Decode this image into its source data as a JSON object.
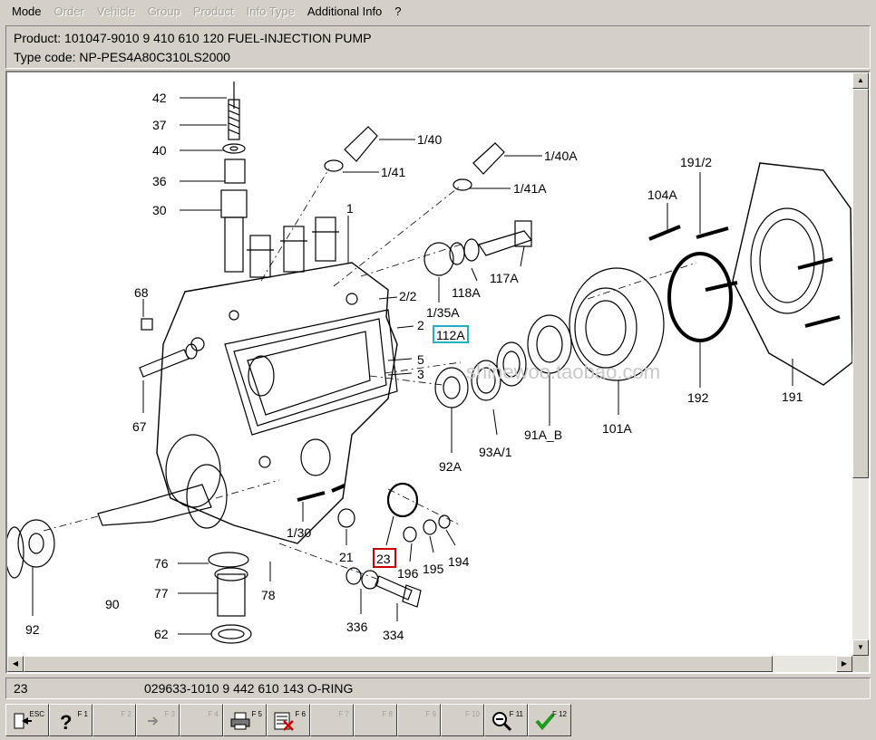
{
  "menu": {
    "items": [
      {
        "label": "Mode",
        "enabled": true
      },
      {
        "label": "Order",
        "enabled": false
      },
      {
        "label": "Vehicle",
        "enabled": false
      },
      {
        "label": "Group",
        "enabled": false
      },
      {
        "label": "Product",
        "enabled": false
      },
      {
        "label": "Info Type",
        "enabled": false
      },
      {
        "label": "Additional Info",
        "enabled": true
      },
      {
        "label": "?",
        "enabled": true
      }
    ]
  },
  "info": {
    "product": "Product:  101047-9010  9 410 610 120  FUEL-INJECTION PUMP",
    "type_code": "Type code: NP-PES4A80C310LS2000"
  },
  "diagram": {
    "watermark": "shinewoo.taobao.com",
    "labels": {
      "l42": "42",
      "l37": "37",
      "l40": "40",
      "l36": "36",
      "l30": "30",
      "l1_40": "1/40",
      "l1_41": "1/41",
      "l1_40A": "1/40A",
      "l1_41A": "1/41A",
      "l1": "1",
      "l191_2": "191/2",
      "l104A": "104A",
      "l68": "68",
      "l117A": "117A",
      "l118A": "118A",
      "l1_35A": "1/35A",
      "l2_2": "2/2",
      "l2": "2",
      "l112A": "112A",
      "l5": "5",
      "l3": "3",
      "l67": "67",
      "l92A": "92A",
      "l93A_1": "93A/1",
      "l91A_B": "91A_B",
      "l101A": "101A",
      "l192": "192",
      "l191": "191",
      "l1_30": "1/30",
      "l21": "21",
      "l23": "23",
      "l196": "196",
      "l195": "195",
      "l194": "194",
      "l76": "76",
      "l78": "78",
      "l77": "77",
      "l90": "90",
      "l92": "92",
      "l62": "62",
      "l336": "336",
      "l334": "334"
    },
    "highlight_selected": "#cc0000",
    "highlight_hover": "#20b0c0"
  },
  "selection": {
    "position": "23",
    "description": "029633-1010  9 442 610 143  O-RING"
  },
  "toolbar": {
    "keys": [
      {
        "key": "ESC",
        "icon": "exit-icon",
        "enabled": true
      },
      {
        "key": "F 1",
        "icon": "help-icon",
        "enabled": true
      },
      {
        "key": "F 2",
        "icon": "",
        "enabled": false
      },
      {
        "key": "F 3",
        "icon": "arrow-right-icon",
        "enabled": false
      },
      {
        "key": "F 4",
        "icon": "",
        "enabled": false
      },
      {
        "key": "F 5",
        "icon": "print-icon",
        "enabled": true
      },
      {
        "key": "F 6",
        "icon": "delete-list-icon",
        "enabled": true
      },
      {
        "key": "F 7",
        "icon": "",
        "enabled": false
      },
      {
        "key": "F 8",
        "icon": "",
        "enabled": false
      },
      {
        "key": "F 9",
        "icon": "",
        "enabled": false
      },
      {
        "key": "F 10",
        "icon": "",
        "enabled": false
      },
      {
        "key": "F 11",
        "icon": "zoom-icon",
        "enabled": true
      },
      {
        "key": "F 12",
        "icon": "checkmark-icon",
        "enabled": true
      }
    ]
  }
}
